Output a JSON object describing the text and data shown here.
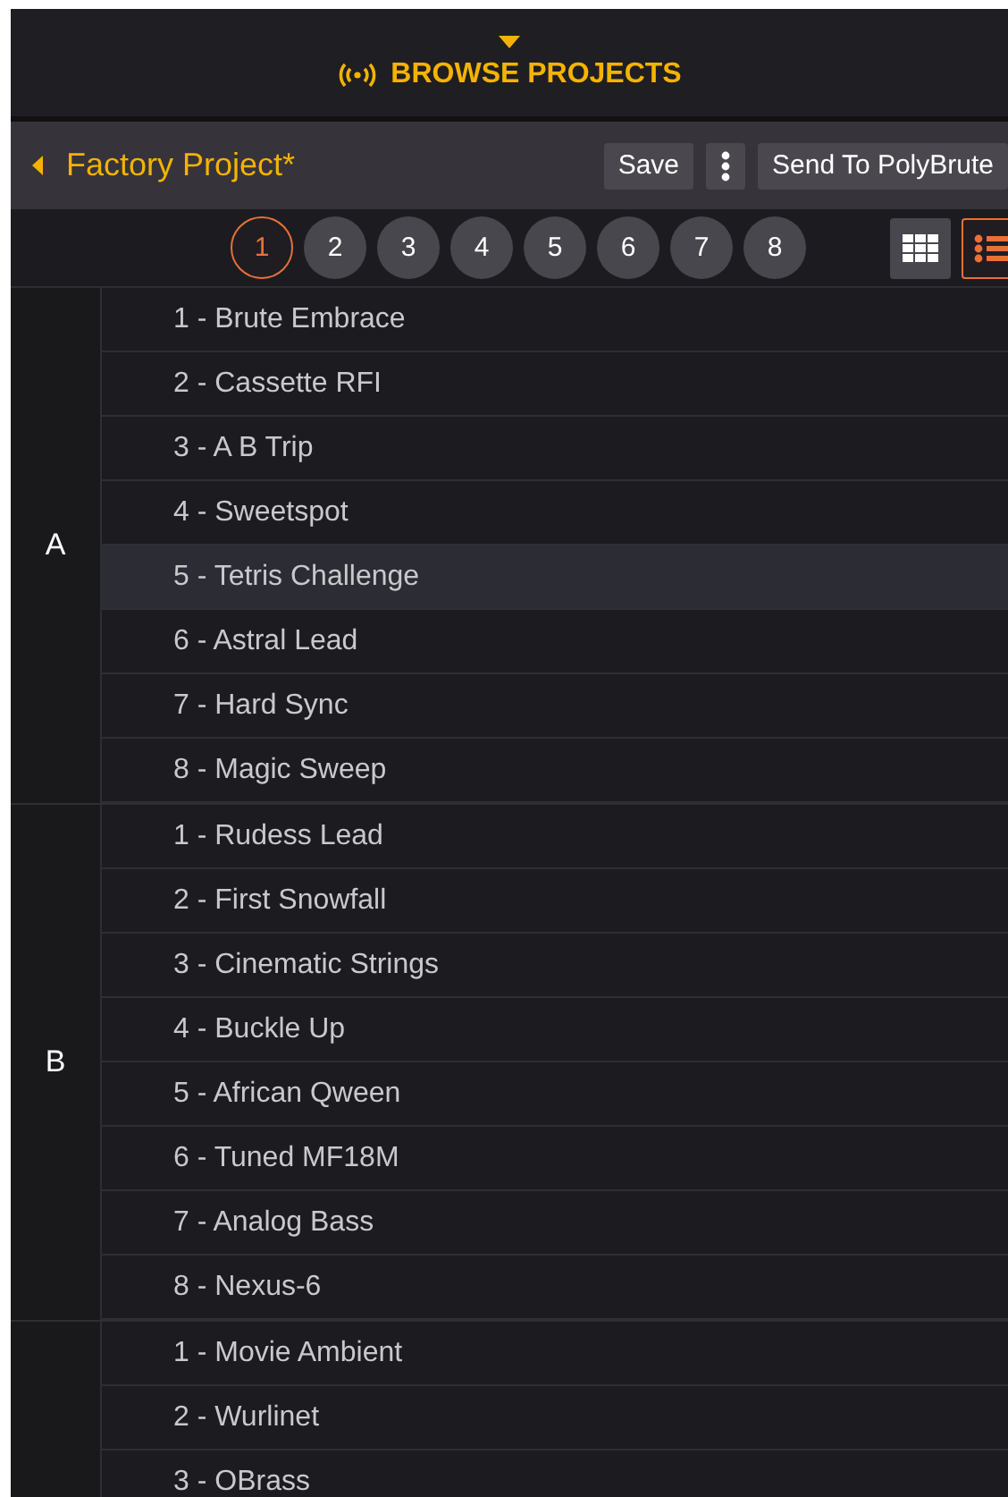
{
  "header": {
    "title": "BROWSE PROJECTS"
  },
  "project_bar": {
    "title": "Factory Project*",
    "buttons": [
      "Save",
      "Send To PolyBrute"
    ]
  },
  "pages": [
    {
      "label": "1",
      "selected": true
    },
    {
      "label": "2",
      "selected": false
    },
    {
      "label": "3",
      "selected": false
    },
    {
      "label": "4",
      "selected": false
    },
    {
      "label": "5",
      "selected": false
    },
    {
      "label": "6",
      "selected": false
    },
    {
      "label": "7",
      "selected": false
    },
    {
      "label": "8",
      "selected": false
    }
  ],
  "view_modes": [
    {
      "kind": "grid",
      "selected": false
    },
    {
      "kind": "list",
      "selected": true
    }
  ],
  "groups": [
    {
      "label": "A",
      "items": [
        {
          "name": "1 - Brute Embrace",
          "selected": false
        },
        {
          "name": "2 - Cassette RFI",
          "selected": false
        },
        {
          "name": "3 - A B Trip",
          "selected": false
        },
        {
          "name": "4 - Sweetspot",
          "selected": false
        },
        {
          "name": "5 - Tetris Challenge",
          "selected": true
        },
        {
          "name": "6 - Astral Lead",
          "selected": false
        },
        {
          "name": "7 - Hard Sync",
          "selected": false
        },
        {
          "name": "8 - Magic Sweep",
          "selected": false
        }
      ]
    },
    {
      "label": "B",
      "items": [
        {
          "name": "1 - Rudess Lead",
          "selected": false
        },
        {
          "name": "2 - First Snowfall",
          "selected": false
        },
        {
          "name": "3 - Cinematic Strings",
          "selected": false
        },
        {
          "name": "4 - Buckle Up",
          "selected": false
        },
        {
          "name": "5 - African Qween",
          "selected": false
        },
        {
          "name": "6 - Tuned MF18M",
          "selected": false
        },
        {
          "name": "7 - Analog Bass",
          "selected": false
        },
        {
          "name": "8 - Nexus-6",
          "selected": false
        }
      ]
    },
    {
      "items": [
        {
          "name": "1 - Movie Ambient",
          "selected": false
        },
        {
          "name": "2 - Wurlinet",
          "selected": false
        },
        {
          "name": "3 - OBrass",
          "selected": false
        }
      ]
    }
  ]
}
